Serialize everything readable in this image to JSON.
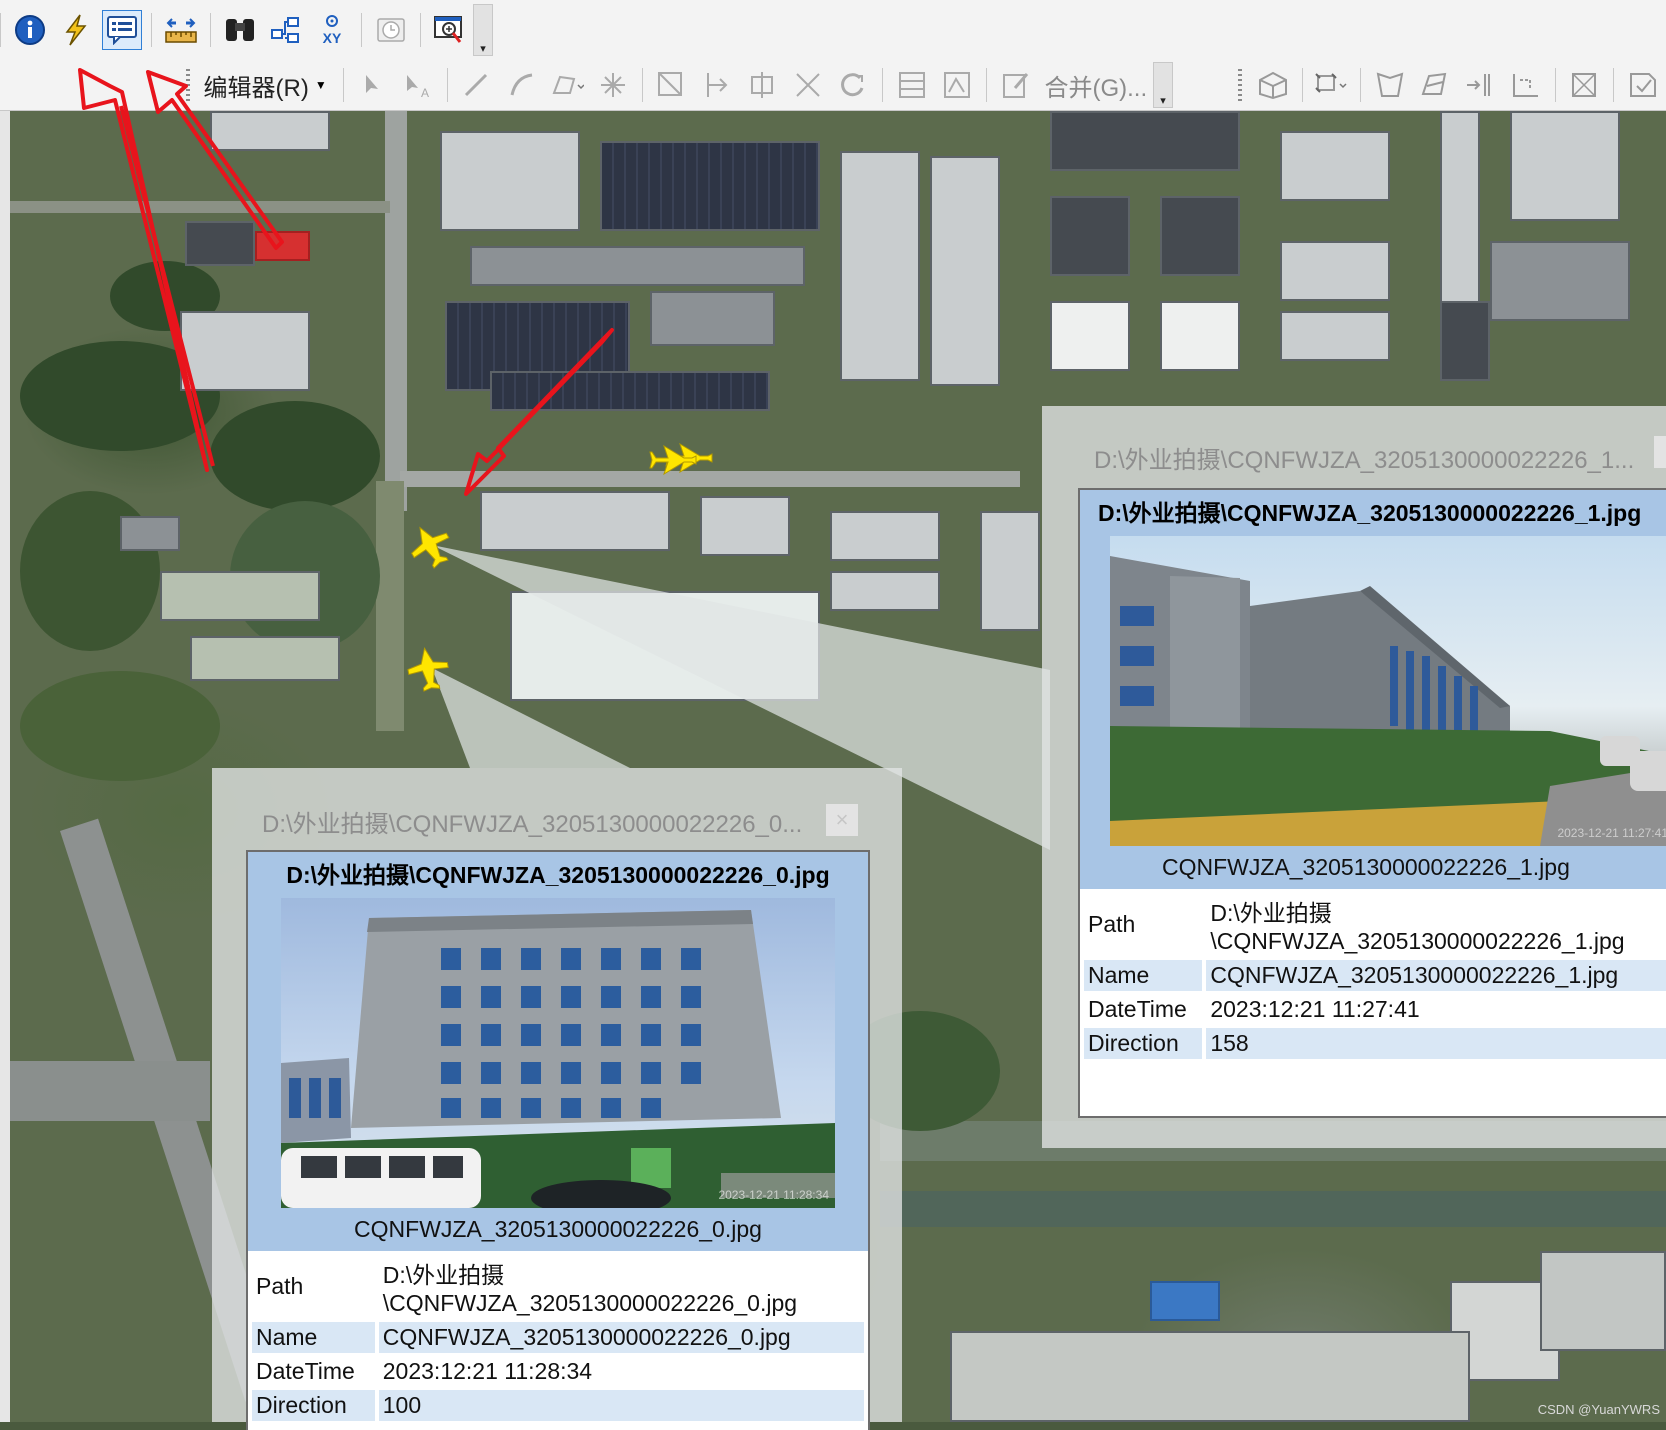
{
  "toolbar_main": {
    "editor_menu_label": "编辑器(R)",
    "merge_label": "合并(G)...",
    "icons": [
      "info-icon",
      "lightning-icon",
      "html-popup-icon",
      "measure-icon",
      "find-binoculars-icon",
      "route-icon",
      "xy-goto-icon",
      "time-slider-icon",
      "magnifier-window-icon"
    ]
  },
  "popup_0": {
    "window_title": "D:\\外业拍摄\\CQNFWJZA_3205130000022226_0...",
    "close_symbol": "×",
    "header_filename": "D:\\外业拍摄\\CQNFWJZA_3205130000022226_0.jpg",
    "photo_caption": "CQNFWJZA_3205130000022226_0.jpg",
    "photo_timestamp": "2023-12-21 11:28:34",
    "rows": [
      {
        "key": "Path",
        "value_line1": "D:\\外业拍摄",
        "value_line2": "\\CQNFWJZA_3205130000022226_0.jpg"
      },
      {
        "key": "Name",
        "value": "CQNFWJZA_3205130000022226_0.jpg"
      },
      {
        "key": "DateTime",
        "value": "2023:12:21 11:28:34"
      },
      {
        "key": "Direction",
        "value": "100"
      }
    ]
  },
  "popup_1": {
    "window_title": "D:\\外业拍摄\\CQNFWJZA_3205130000022226_1...",
    "header_filename": "D:\\外业拍摄\\CQNFWJZA_3205130000022226_1.jpg",
    "photo_caption": "CQNFWJZA_3205130000022226_1.jpg",
    "photo_timestamp": "2023-12-21 11:27:41",
    "rows": [
      {
        "key": "Path",
        "value_line1": "D:\\外业拍摄",
        "value_line2": "\\CQNFWJZA_3205130000022226_1.jpg"
      },
      {
        "key": "Name",
        "value": "CQNFWJZA_3205130000022226_1.jpg"
      },
      {
        "key": "DateTime",
        "value": "2023:12:21 11:27:41"
      },
      {
        "key": "Direction",
        "value": "158"
      }
    ]
  },
  "watermark": "CSDN @YuanYWRS",
  "colors": {
    "arrow": "#e8141c",
    "marker": "#ffe600",
    "popup_header": "#a8c5e5",
    "row_alt": "#d9e7f5",
    "toolbar_bg": "#f3f3f3"
  }
}
